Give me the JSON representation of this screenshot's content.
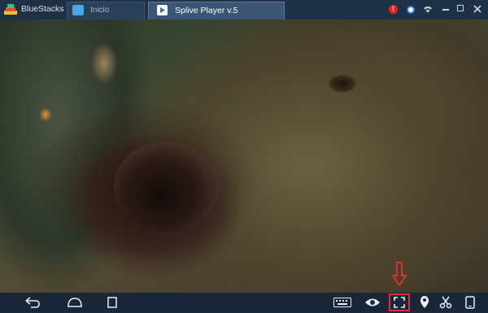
{
  "app": {
    "name": "BlueStacks"
  },
  "tabs": [
    {
      "label": "Inicio",
      "icon": "home-icon",
      "active": false
    },
    {
      "label": "Splive Player v.5",
      "icon": "splive-icon",
      "active": true
    }
  ],
  "titlebar": {
    "alert_glyph": "!"
  },
  "bottombar": {
    "back": "back-icon",
    "home": "home-icon",
    "recent": "recent-apps-icon",
    "keyboard": "keyboard-icon",
    "eye": "eye-icon",
    "fullscreen": "fullscreen-icon",
    "location": "location-pin-icon",
    "cut": "scissors-icon",
    "rotate": "phone-rotate-icon"
  },
  "colors": {
    "accent_red": "#e03030",
    "titlebar_bg": "#1f3146",
    "bottombar_bg": "#1a2738"
  }
}
